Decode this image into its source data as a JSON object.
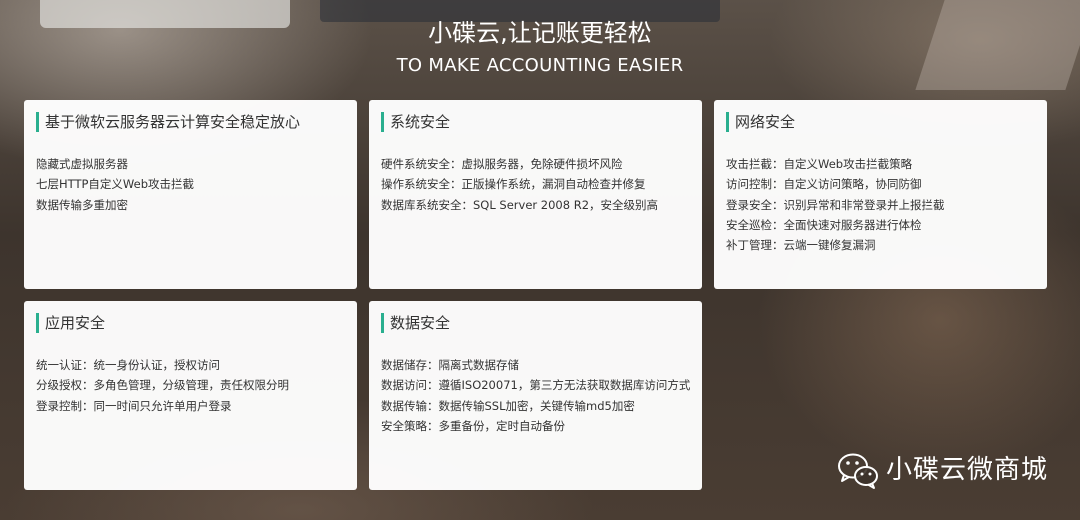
{
  "heading": {
    "zh": "小碟云,让记账更轻松",
    "en": "TO MAKE ACCOUNTING EASIER"
  },
  "cards": [
    {
      "title": "基于微软云服务器云计算安全稳定放心",
      "items": [
        "隐藏式虚拟服务器",
        "七层HTTP自定义Web攻击拦截",
        "数据传输多重加密"
      ]
    },
    {
      "title": "系统安全",
      "items": [
        "硬件系统安全：虚拟服务器，免除硬件损坏风险",
        "操作系统安全：正版操作系统，漏洞自动检查并修复",
        "数据库系统安全：SQL Server 2008 R2，安全级别高"
      ]
    },
    {
      "title": "网络安全",
      "items": [
        "攻击拦截：自定义Web攻击拦截策略",
        "访问控制：自定义访问策略，协同防御",
        "登录安全：识别异常和非常登录并上报拦截",
        "安全巡检：全面快速对服务器进行体检",
        "补丁管理：云端一键修复漏洞"
      ]
    },
    {
      "title": "应用安全",
      "items": [
        "统一认证：统一身份认证，授权访问",
        "分级授权：多角色管理，分级管理，责任权限分明",
        "登录控制：同一时间只允许单用户登录"
      ]
    },
    {
      "title": "数据安全",
      "items": [
        "数据储存：隔离式数据存储",
        "数据访问：遵循ISO20071，第三方无法获取数据库访问方式",
        "数据传输：数据传输SSL加密，关键传输md5加密",
        "安全策略：多重备份，定时自动备份"
      ]
    }
  ],
  "watermark": {
    "icon": "wechat-icon",
    "text": "小碟云微商城"
  },
  "colors": {
    "accent": "#2aaf8f",
    "card_bg": "#ffffff",
    "heading_text": "#ffffff"
  }
}
